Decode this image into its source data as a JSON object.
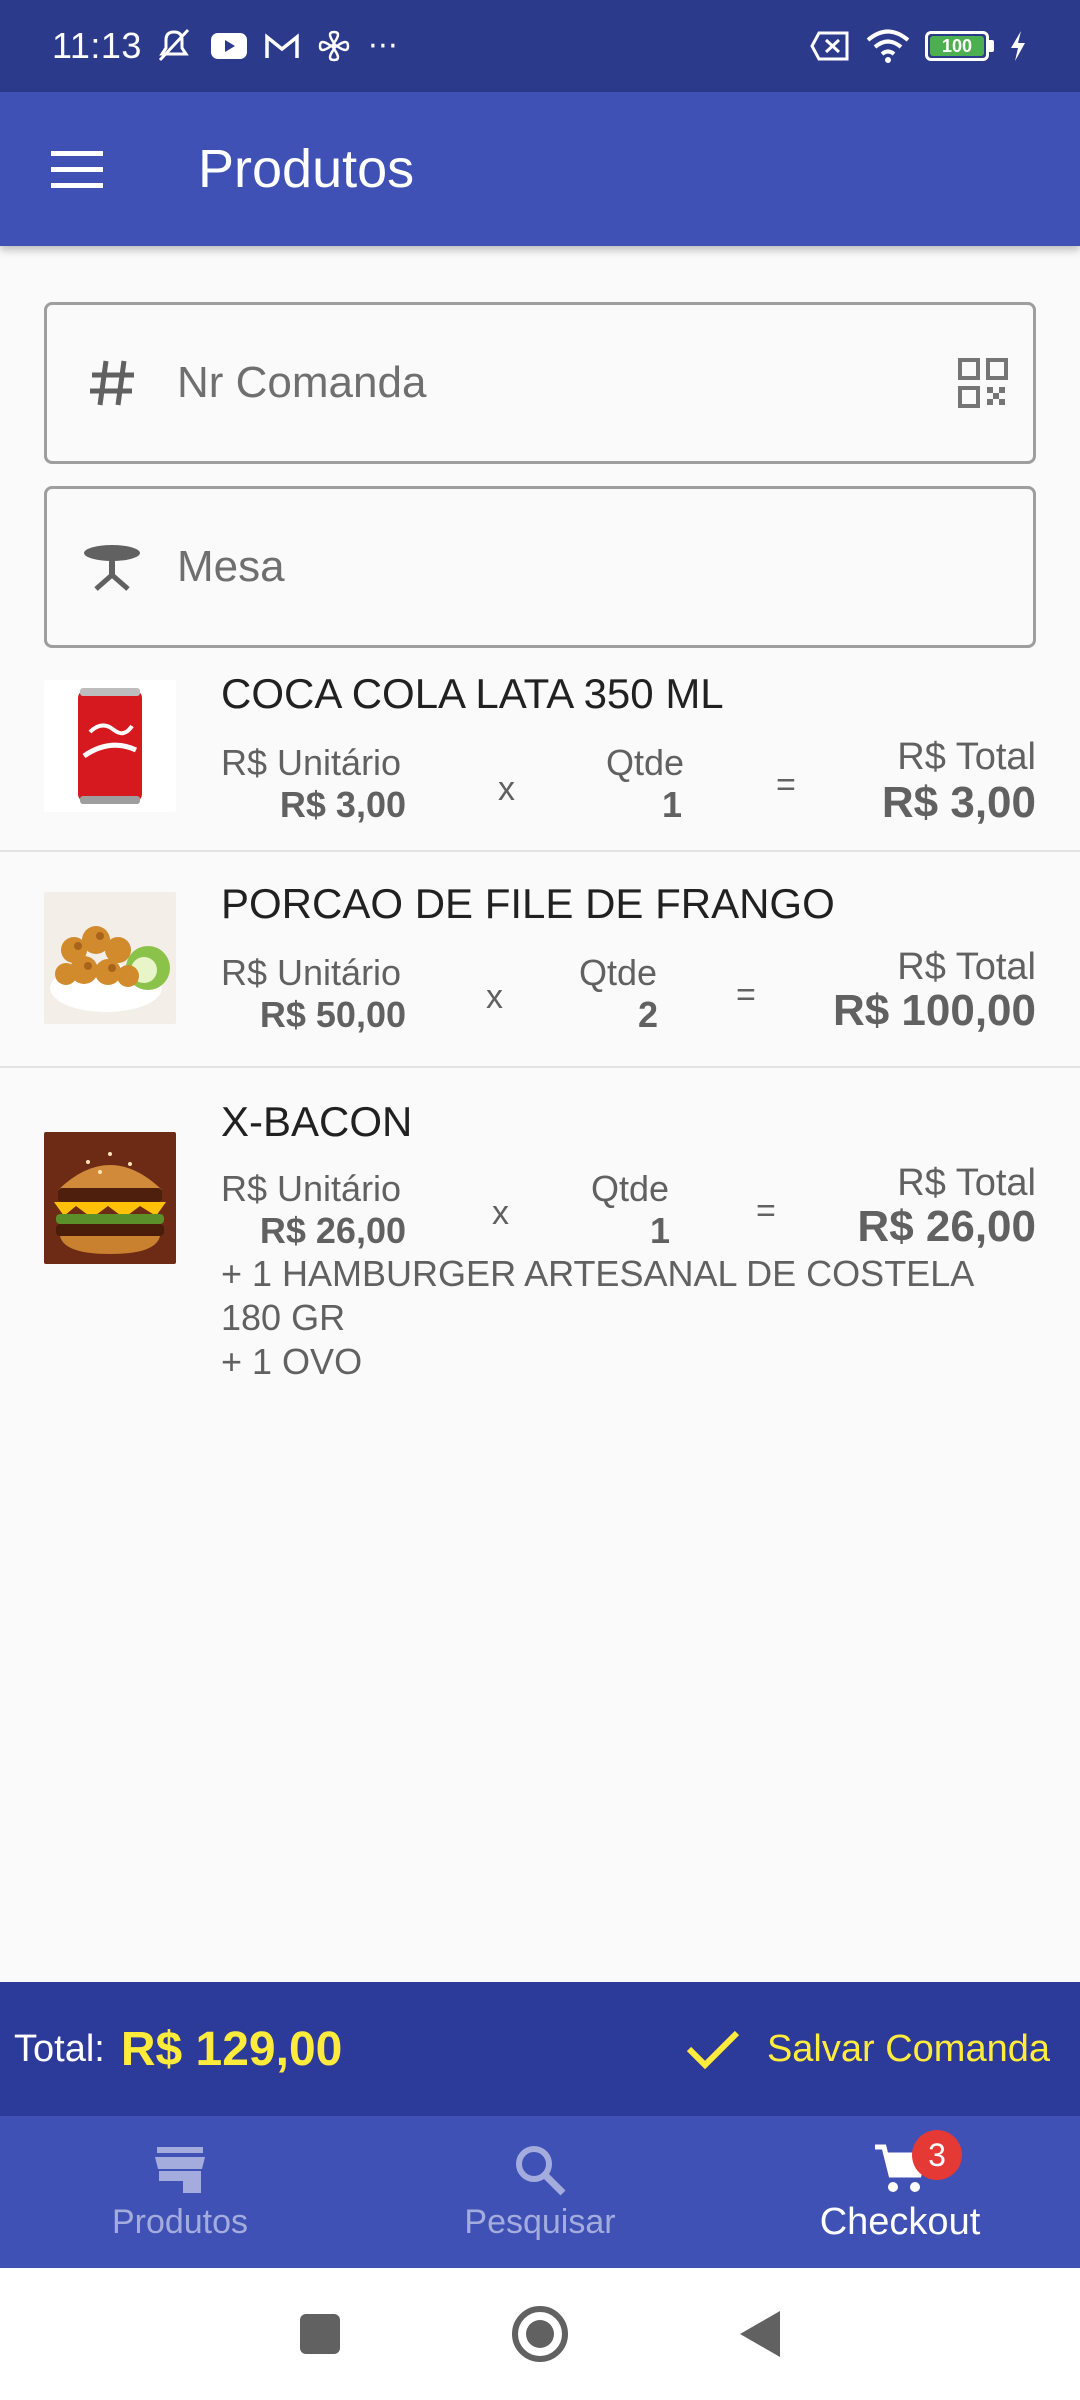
{
  "status_bar": {
    "time": "11:13",
    "battery": "100"
  },
  "app_bar": {
    "title": "Produtos"
  },
  "comanda_field": {
    "placeholder": "Nr Comanda"
  },
  "mesa_field": {
    "placeholder": "Mesa"
  },
  "items": [
    {
      "name": "COCA COLA LATA 350 ML",
      "unit_label": "R$ Unitário",
      "unit_price": "R$ 3,00",
      "times": "x",
      "qty_label": "Qtde",
      "qty": "1",
      "equals": "=",
      "total_label": "R$ Total",
      "total": "R$ 3,00"
    },
    {
      "name": "PORCAO DE FILE DE FRANGO",
      "unit_label": "R$ Unitário",
      "unit_price": "R$ 50,00",
      "times": "x",
      "qty_label": "Qtde",
      "qty": "2",
      "equals": "=",
      "total_label": "R$ Total",
      "total": "R$ 100,00"
    },
    {
      "name": "X-BACON",
      "unit_label": "R$ Unitário",
      "unit_price": "R$ 26,00",
      "times": "x",
      "qty_label": "Qtde",
      "qty": "1",
      "equals": "=",
      "total_label": "R$ Total",
      "total": "R$ 26,00",
      "addons": [
        "+ 1 HAMBURGER ARTESANAL DE COSTELA 180 GR",
        "+ 1 OVO"
      ]
    }
  ],
  "summary": {
    "label": "Total:",
    "total": "R$ 129,00",
    "save_label": "Salvar Comanda"
  },
  "bottom_nav": {
    "items": [
      {
        "label": "Produtos",
        "icon": "store-icon"
      },
      {
        "label": "Pesquisar",
        "icon": "search-icon"
      },
      {
        "label": "Checkout",
        "icon": "cart-icon",
        "badge": "3",
        "active": true
      }
    ]
  },
  "colors": {
    "primary": "#3f51b5",
    "primary_dark": "#2c3a8c",
    "accent": "#ffeb3b",
    "badge": "#e53935"
  }
}
